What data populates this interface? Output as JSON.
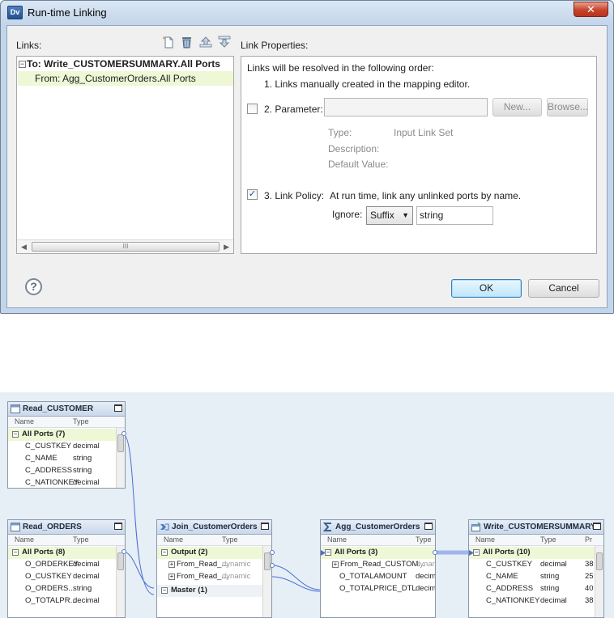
{
  "dialog": {
    "title": "Run-time Linking",
    "app_icon": "Dv",
    "close_label": "✕",
    "links_label": "Links:",
    "link_properties_label": "Link Properties:",
    "toolbar_icons": [
      "new-link-icon",
      "delete-icon",
      "move-up-icon",
      "move-down-icon"
    ],
    "tree": {
      "root": "To: Write_CUSTOMERSUMMARY.All Ports",
      "child": "From: Agg_CustomerOrders.All Ports"
    },
    "scroll_grip": "III",
    "props": {
      "intro": "Links will be resolved in the following order:",
      "step1": "1. Links manually created in the mapping editor.",
      "parameter_label": "2. Parameter:",
      "parameter_checked": false,
      "parameter_value": "",
      "new_button": "New...",
      "browse_button": "Browse...",
      "type_label": "Type:",
      "type_value": "Input Link Set",
      "description_label": "Description:",
      "default_label": "Default Value:",
      "policy_label": "3. Link Policy:",
      "policy_checked": true,
      "policy_text": "At run time, link any unlinked ports by name.",
      "ignore_label": "Ignore:",
      "ignore_option": "Suffix",
      "ignore_value": "string"
    },
    "ok_button": "OK",
    "cancel_button": "Cancel",
    "help_glyph": "?"
  },
  "canvas": {
    "nodes": {
      "read_customer": {
        "title": "Read_CUSTOMER",
        "col_name": "Name",
        "col_type": "Type",
        "group": "All Ports (7)",
        "rows": [
          {
            "name": "C_CUSTKEY",
            "type": "decimal"
          },
          {
            "name": "C_NAME",
            "type": "string"
          },
          {
            "name": "C_ADDRESS",
            "type": "string"
          },
          {
            "name": "C_NATIONKEY",
            "type": "decimal"
          }
        ]
      },
      "read_orders": {
        "title": "Read_ORDERS",
        "col_name": "Name",
        "col_type": "Type",
        "group": "All Ports (8)",
        "rows": [
          {
            "name": "O_ORDERKEY",
            "type": "decimal"
          },
          {
            "name": "O_CUSTKEY",
            "type": "decimal"
          },
          {
            "name": "O_ORDERS...",
            "type": "string"
          },
          {
            "name": "O_TOTALPR...",
            "type": "decimal"
          }
        ]
      },
      "join": {
        "title": "Join_CustomerOrders",
        "col_name": "Name",
        "col_type": "Type",
        "group1": "Output (2)",
        "rows": [
          {
            "name": "From_Read_...",
            "type": "dynamic"
          },
          {
            "name": "From_Read_...",
            "type": "dynamic"
          }
        ],
        "group2": "Master (1)"
      },
      "agg": {
        "title": "Agg_CustomerOrders",
        "col_name": "Name",
        "col_type": "Type",
        "group": "All Ports (3)",
        "rows": [
          {
            "name": "From_Read_CUSTOM...",
            "type": "dynamic"
          },
          {
            "name": "O_TOTALAMOUNT",
            "type": "decimal"
          },
          {
            "name": "O_TOTALPRICE_DTL",
            "type": "decimal"
          }
        ]
      },
      "write": {
        "title": "Write_CUSTOMERSUMMARY",
        "col_name": "Name",
        "col_type": "Type",
        "col_prec": "Pr",
        "group": "All Ports (10)",
        "rows": [
          {
            "name": "C_CUSTKEY",
            "type": "decimal",
            "prec": "38"
          },
          {
            "name": "C_NAME",
            "type": "string",
            "prec": "25"
          },
          {
            "name": "C_ADDRESS",
            "type": "string",
            "prec": "40"
          },
          {
            "name": "C_NATIONKEY",
            "type": "decimal",
            "prec": "38"
          }
        ]
      }
    },
    "colors": {
      "wire": "#4a6fd1",
      "group_bg": "#eef7d6",
      "canvas_bg": "#e6eef6"
    }
  }
}
